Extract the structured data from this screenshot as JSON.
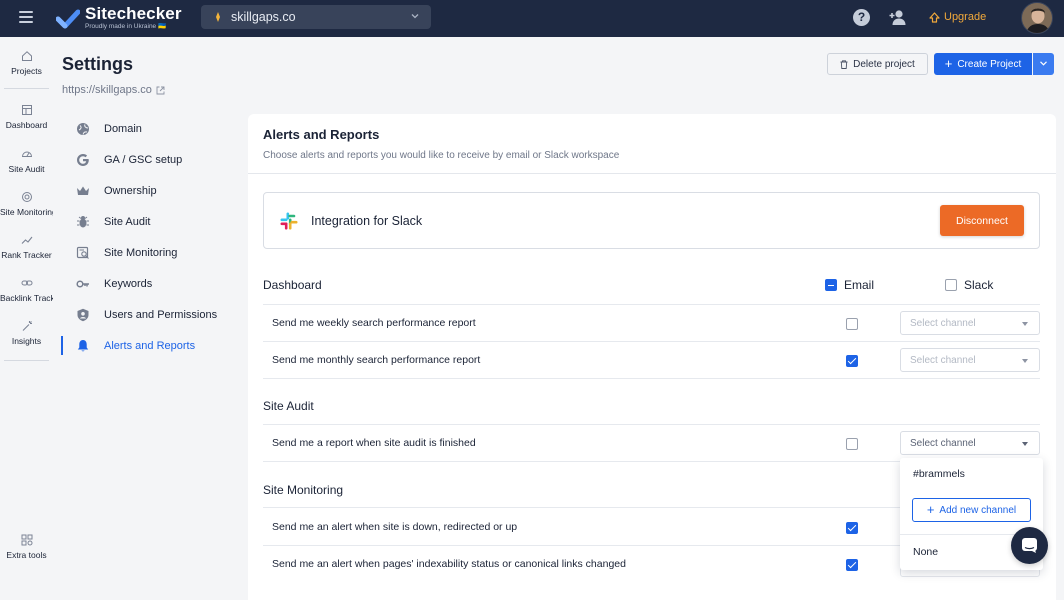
{
  "topbar": {
    "logo_name": "Sitechecker",
    "logo_tagline": "Proudly made in Ukraine 🇺🇦",
    "project": "skillgaps.co",
    "help_glyph": "?",
    "upgrade_label": "Upgrade",
    "icons": [
      "menu-icon",
      "help-icon",
      "add-user-icon",
      "upgrade-icon",
      "avatar"
    ]
  },
  "rail": {
    "items": [
      {
        "label": "Projects",
        "icon": "home-icon"
      },
      {
        "label": "Dashboard",
        "icon": "dashboard-icon"
      },
      {
        "label": "Site Audit",
        "icon": "gauge-icon"
      },
      {
        "label": "Site Monitoring",
        "icon": "radar-icon"
      },
      {
        "label": "Rank Tracker",
        "icon": "trend-icon"
      },
      {
        "label": "Backlink Tracker",
        "icon": "link-icon"
      },
      {
        "label": "Insights",
        "icon": "wand-icon"
      }
    ],
    "extra_tools": "Extra tools"
  },
  "header": {
    "title": "Settings",
    "url": "https://skillgaps.co",
    "delete_label": "Delete project",
    "create_label": "Create Project"
  },
  "settings_nav": [
    {
      "label": "Domain",
      "icon": "globe-icon"
    },
    {
      "label": "GA / GSC setup",
      "icon": "google-icon"
    },
    {
      "label": "Ownership",
      "icon": "crown-icon"
    },
    {
      "label": "Site Audit",
      "icon": "bug-icon"
    },
    {
      "label": "Site Monitoring",
      "icon": "monitor-search-icon"
    },
    {
      "label": "Keywords",
      "icon": "key-icon"
    },
    {
      "label": "Users and Permissions",
      "icon": "user-shield-icon"
    },
    {
      "label": "Alerts and Reports",
      "icon": "bell-icon",
      "active": true
    }
  ],
  "panel": {
    "title": "Alerts and Reports",
    "subtitle": "Choose alerts and reports you would like to receive by email or Slack workspace",
    "slack_card_title": "Integration for Slack",
    "disconnect_label": "Disconnect",
    "email_label": "Email",
    "slack_label": "Slack",
    "accent": "#1d63e6",
    "danger": "#ec6a26",
    "sections": [
      {
        "title": "Dashboard",
        "rows": [
          {
            "text": "Send me weekly search performance report",
            "email": false,
            "channel": "Select channel"
          },
          {
            "text": "Send me monthly search performance report",
            "email": true,
            "channel": "Select channel"
          }
        ]
      },
      {
        "title": "Site Audit",
        "rows": [
          {
            "text": "Send me a report when site audit is finished",
            "email": false,
            "channel": "Select channel"
          }
        ]
      },
      {
        "title": "Site Monitoring",
        "rows": [
          {
            "text": "Send me an alert when site is down, redirected or up",
            "email": true
          },
          {
            "text": "Send me an alert when pages' indexability status or canonical links changed",
            "email": true
          }
        ]
      }
    ]
  },
  "dropdown": {
    "channel": "#brammels",
    "add_label": "Add new channel",
    "none_label": "None"
  }
}
